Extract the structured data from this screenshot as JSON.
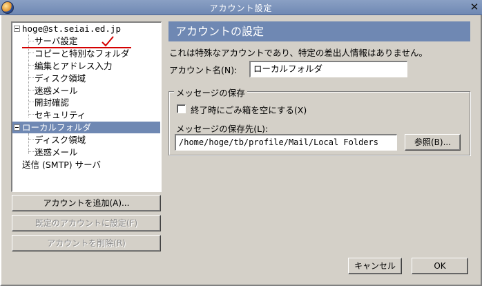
{
  "window": {
    "title": "アカウント設定",
    "close_glyph": "✕"
  },
  "tree": {
    "accounts": [
      {
        "label": "hoge@st.seiai.ed.jp",
        "children": [
          "サーバ設定",
          "コピーと特別なフォルダ",
          "編集とアドレス入力",
          "ディスク領域",
          "迷惑メール",
          "開封確認",
          "セキュリティ"
        ]
      },
      {
        "label": "ローカルフォルダ",
        "selected": true,
        "children": [
          "ディスク領域",
          "迷惑メール"
        ]
      }
    ],
    "smtp_label": "送信 (SMTP) サーバ",
    "annotation_color": "#d40000"
  },
  "buttons": {
    "add_account": "アカウントを追加(A)...",
    "set_default": "既定のアカウントに設定(F)",
    "remove_account": "アカウントを削除(R)",
    "cancel": "キャンセル",
    "ok": "OK"
  },
  "panel": {
    "header": "アカウントの設定",
    "info": "これは特殊なアカウントであり、特定の差出人情報はありません。",
    "account_name_label": "アカウント名(N):",
    "account_name_value": "ローカルフォルダ",
    "storage_group_label": "メッセージの保存",
    "empty_trash_label": "終了時にごみ箱を空にする(X)",
    "empty_trash_checked": false,
    "storage_path_label": "メッセージの保存先(L):",
    "storage_path_value": "/home/hoge/tb/profile/Mail/Local Folders",
    "browse_button": "参照(B)..."
  },
  "colors": {
    "accent": "#6f88b3",
    "window_bg": "#d4d0c8"
  }
}
